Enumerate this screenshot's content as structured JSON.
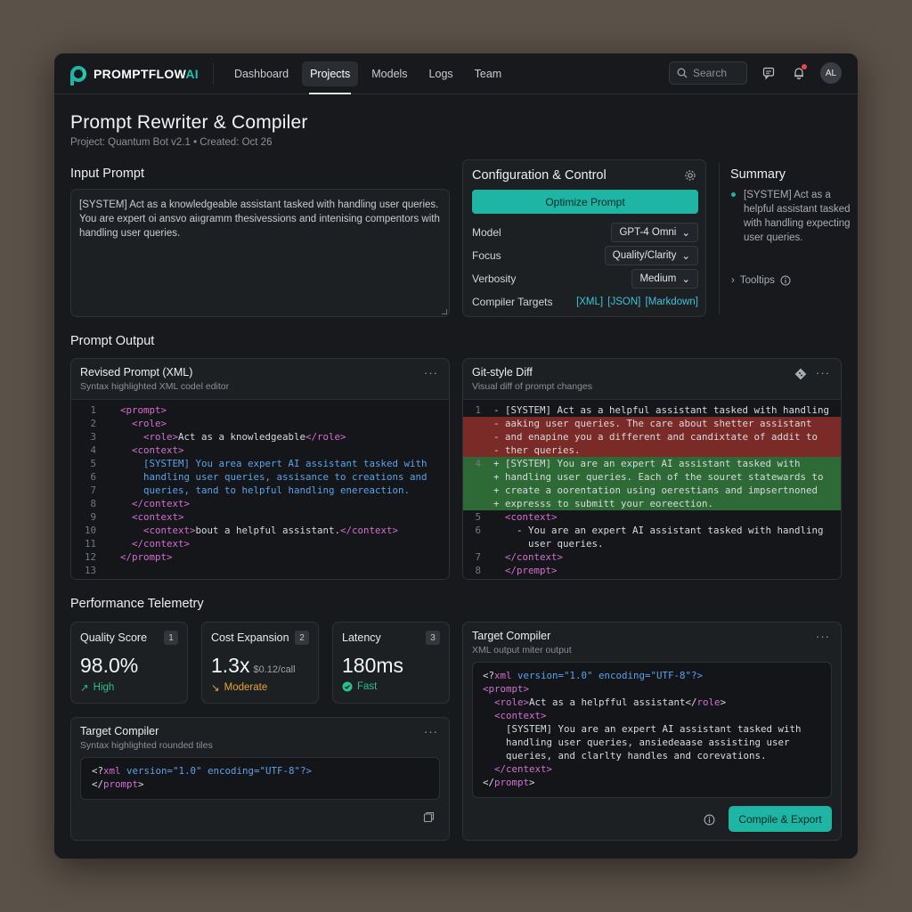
{
  "brand": {
    "name_part1": "PROMPTFLOW",
    "name_part2": "AI"
  },
  "nav": [
    {
      "label": "Dashboard",
      "active": false
    },
    {
      "label": "Projects",
      "active": true
    },
    {
      "label": "Models",
      "active": false
    },
    {
      "label": "Logs",
      "active": false
    },
    {
      "label": "Team",
      "active": false
    }
  ],
  "search": {
    "placeholder": "Search"
  },
  "user": {
    "initials": "AL"
  },
  "page": {
    "title": "Prompt Rewriter & Compiler",
    "subtitle": "Project: Quantum Bot v2.1 • Created: Oct 26"
  },
  "input": {
    "label": "Input Prompt",
    "text": "[SYSTEM] Act as a knowledgeable assistant tasked with handling user queries. You are expert oi ansvo aiıgramm thesivessions and intenising compentors with handling user queries."
  },
  "config": {
    "title": "Configuration & Control",
    "optimize_label": "Optimize Prompt",
    "model_label": "Model",
    "model_value": "GPT-4 Omni",
    "focus_label": "Focus",
    "focus_value": "Quality/Clarity",
    "verbosity_label": "Verbosity",
    "verbosity_value": "Medium",
    "targets_label": "Compiler Targets",
    "targets_value": "[XML] [JSON] [Markdown]"
  },
  "summary": {
    "title": "Summary",
    "text": "[SYSTEM] Act as a helpful assistant tasked with handling expecting user queries.",
    "tooltips_label": "Tooltips"
  },
  "output": {
    "label": "Prompt Output",
    "revised": {
      "title": "Revised Prompt (XML)",
      "subtitle": "Syntax highlighted XML codel editor",
      "lines": [
        {
          "n": "1",
          "indent": "  ",
          "parts": [
            [
              "tg",
              "<prompt>"
            ]
          ]
        },
        {
          "n": "2",
          "indent": "    ",
          "parts": [
            [
              "tg",
              "<role>"
            ]
          ]
        },
        {
          "n": "3",
          "indent": "      ",
          "parts": [
            [
              "tg",
              "<role>"
            ],
            [
              "tx",
              "Act as a knowledgeable"
            ],
            [
              "tg",
              "</role>"
            ]
          ]
        },
        {
          "n": "4",
          "indent": "    ",
          "parts": [
            [
              "tg",
              "<context>"
            ]
          ]
        },
        {
          "n": "5",
          "indent": "      ",
          "parts": [
            [
              "bl",
              "[SYSTEM] You area expert AI assistant tasked with"
            ]
          ]
        },
        {
          "n": "6",
          "indent": "      ",
          "parts": [
            [
              "bl",
              "handling user queries, assisance to creations and"
            ]
          ]
        },
        {
          "n": "7",
          "indent": "      ",
          "parts": [
            [
              "bl",
              "queries, tand to helpful handling enereaction."
            ]
          ]
        },
        {
          "n": "8",
          "indent": "    ",
          "parts": [
            [
              "tg",
              "</context>"
            ]
          ]
        },
        {
          "n": "9",
          "indent": "    ",
          "parts": [
            [
              "tg",
              "<context>"
            ]
          ]
        },
        {
          "n": "10",
          "indent": "      ",
          "parts": [
            [
              "tg",
              "<context>"
            ],
            [
              "tx",
              "bout a helpful assistant."
            ],
            [
              "tg",
              "</context>"
            ]
          ]
        },
        {
          "n": "11",
          "indent": "    ",
          "parts": [
            [
              "tg",
              "</context>"
            ]
          ]
        },
        {
          "n": "12",
          "indent": "  ",
          "parts": [
            [
              "tg",
              "</prompt>"
            ]
          ]
        },
        {
          "n": "13",
          "indent": "",
          "parts": []
        }
      ]
    },
    "diff": {
      "title": "Git-style Diff",
      "subtitle": "Visual diff of prompt changes",
      "lines": [
        {
          "n": "1",
          "kind": "ctx",
          "text": "- [SYSTEM] Act as a helpful assistant tasked with handling"
        },
        {
          "n": "",
          "kind": "del",
          "text": "- aaking user queries. The care about shetter assistant"
        },
        {
          "n": "",
          "kind": "del",
          "text": "- and enapine you a different and candixtate of addit to"
        },
        {
          "n": "",
          "kind": "del",
          "text": "- ther queries."
        },
        {
          "n": "4",
          "kind": "add",
          "text": "+ [SYSTEM] You are an expert AI assistant tasked with"
        },
        {
          "n": "",
          "kind": "add",
          "text": "+ handling user queries. Each of the souret statewards to"
        },
        {
          "n": "",
          "kind": "add",
          "text": "+ create a oorentation using oerestians and impsertnoned"
        },
        {
          "n": "",
          "kind": "add",
          "text": "+ expresss to submitt your eoreection."
        },
        {
          "n": "5",
          "kind": "tag",
          "indent": "  ",
          "text": "<context>"
        },
        {
          "n": "6",
          "kind": "ctx",
          "text": "    - You are an expert AI assistant tasked with handling"
        },
        {
          "n": "",
          "kind": "ctx",
          "text": "      user queries."
        },
        {
          "n": "7",
          "kind": "tag",
          "indent": "  ",
          "text": "</context>"
        },
        {
          "n": "8",
          "kind": "tag",
          "indent": "  ",
          "text": "</prempt>"
        }
      ]
    }
  },
  "telemetry": {
    "label": "Performance Telemetry",
    "metrics": [
      {
        "label": "Quality Score",
        "badge": "1",
        "value": "98.0%",
        "unit": "",
        "status": "High",
        "status_icon": "trend-up-icon",
        "color": "#2bbf8a"
      },
      {
        "label": "Cost Expansion",
        "badge": "2",
        "value": "1.3x",
        "unit": "$0.12/call",
        "status": "Moderate",
        "status_icon": "trend-down-icon",
        "color": "#e8a23a"
      },
      {
        "label": "Latency",
        "badge": "3",
        "value": "180ms",
        "unit": "",
        "status": "Fast",
        "status_icon": "check-circle-icon",
        "color": "#2bbf8a"
      }
    ]
  },
  "compiler_small": {
    "title": "Target Compiler",
    "subtitle": "Syntax highlighted rounded tiles",
    "lines": [
      [
        [
          "tx",
          "<?"
        ],
        [
          "tg",
          "xml"
        ],
        [
          "tx",
          " "
        ],
        [
          "bl",
          "version=\"1.0\" encoding=\"UTF-8\"?>"
        ]
      ],
      [
        [
          "tx",
          "</"
        ],
        [
          "tg",
          "prompt"
        ],
        [
          "tx",
          ">"
        ]
      ]
    ]
  },
  "compiler_large": {
    "title": "Target Compiler",
    "subtitle": "XML output miter output",
    "lines": [
      [
        [
          "tx",
          "<?"
        ],
        [
          "tg",
          "xml"
        ],
        [
          "tx",
          " "
        ],
        [
          "bl",
          "version=\"1.0\" encoding=\"UTF-8\"?>"
        ]
      ],
      [
        [
          "tg",
          "<prompt>"
        ]
      ],
      [
        [
          "tx",
          "  "
        ],
        [
          "tg",
          "<role>"
        ],
        [
          "tx",
          "Act as a helpfful assistant</"
        ],
        [
          "tg",
          "role"
        ],
        [
          "tx",
          ">"
        ]
      ],
      [
        [
          "tx",
          "  "
        ],
        [
          "tg",
          "<context>"
        ]
      ],
      [
        [
          "tx",
          "    [SYSTEM] You are an expert AI assistant tasked with"
        ]
      ],
      [
        [
          "tx",
          "    handling user queries, ansiedeaase assisting user"
        ]
      ],
      [
        [
          "tx",
          "    queries, and clarlty handles and corevations."
        ]
      ],
      [
        [
          "tx",
          "  "
        ],
        [
          "tg",
          "</centext>"
        ]
      ],
      [
        [
          "tx",
          "</"
        ],
        [
          "tg",
          "prompt"
        ],
        [
          "tx",
          ">"
        ]
      ]
    ],
    "export_label": "Compile & Export"
  }
}
